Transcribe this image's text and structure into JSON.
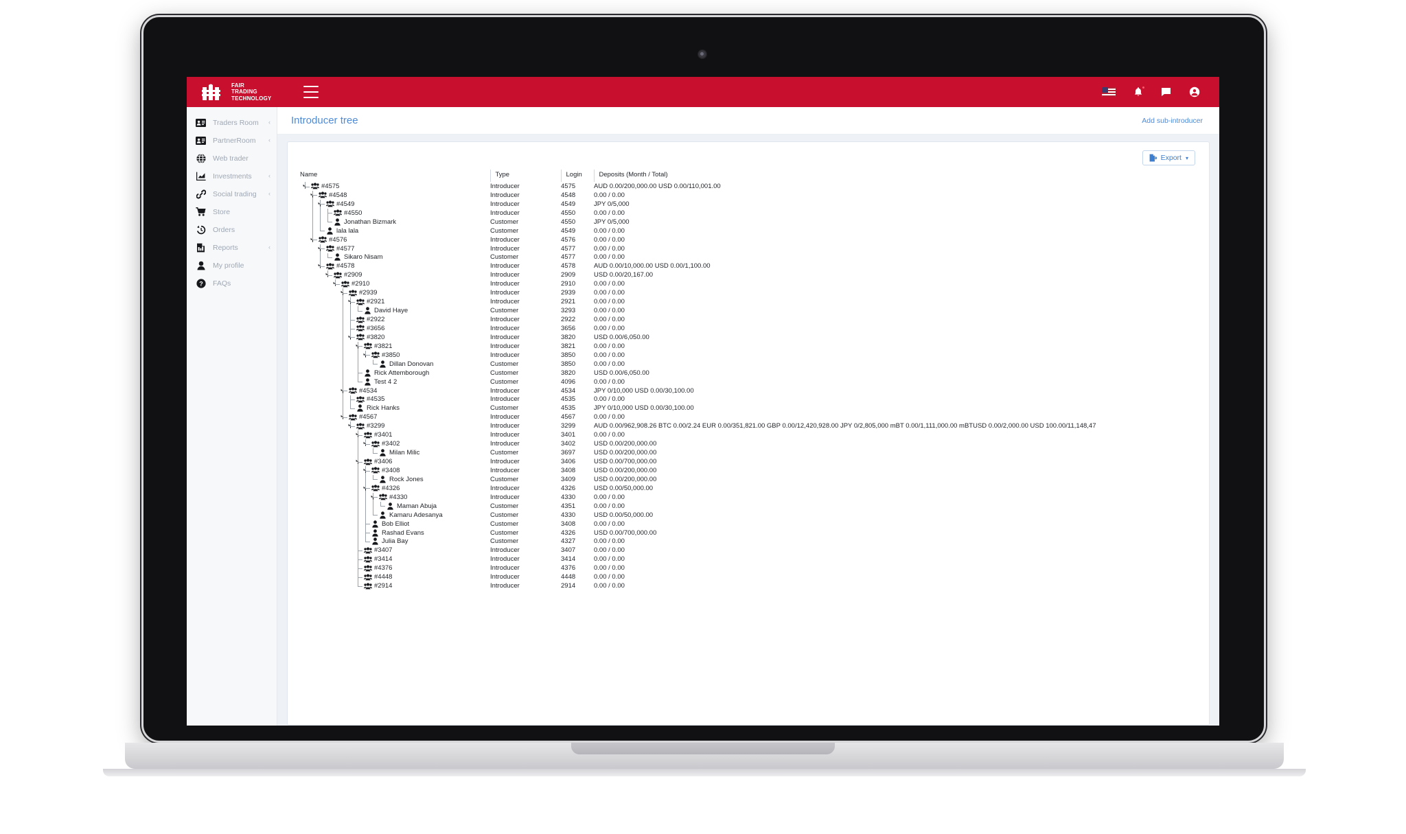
{
  "brand": {
    "line1": "FAIR",
    "line2": "TRADING",
    "line3": "TECHNOLOGY",
    "color": "#c8102e"
  },
  "topbar": {
    "menu_label": "menu",
    "icons": [
      {
        "name": "language-flag-icon",
        "label": "US"
      },
      {
        "name": "notifications-bell-icon",
        "label": "Notifications"
      },
      {
        "name": "messages-icon",
        "label": "Messages"
      },
      {
        "name": "account-icon",
        "label": "Account"
      }
    ]
  },
  "sidebar": {
    "items": [
      {
        "label": "Traders Room",
        "icon": "id-card-icon",
        "caret": "‹"
      },
      {
        "label": "PartnerRoom",
        "icon": "id-card-icon",
        "caret": "‹"
      },
      {
        "label": "Web trader",
        "icon": "globe-icon",
        "caret": ""
      },
      {
        "label": "Investments",
        "icon": "chart-icon",
        "caret": "‹"
      },
      {
        "label": "Social trading",
        "icon": "link-icon",
        "caret": "‹"
      },
      {
        "label": "Store",
        "icon": "cart-icon",
        "caret": ""
      },
      {
        "label": "Orders",
        "icon": "history-icon",
        "caret": ""
      },
      {
        "label": "Reports",
        "icon": "report-icon",
        "caret": "‹"
      },
      {
        "label": "My profile",
        "icon": "user-icon",
        "caret": ""
      },
      {
        "label": "FAQs",
        "icon": "help-icon",
        "caret": ""
      }
    ]
  },
  "page": {
    "title": "Introducer tree",
    "add_action": "Add sub-introducer",
    "export_label": "Export",
    "export_caret": "▾",
    "title_color": "#4f8bd6"
  },
  "table": {
    "columns": [
      "Name",
      "Type",
      "Login",
      "Deposits (Month / Total)"
    ],
    "rows": [
      {
        "depth": 0,
        "kind": "group",
        "name": "#4575",
        "type": "Introducer",
        "login": "4575",
        "deposits": "AUD 0.00/200,000.00 USD 0.00/110,001.00"
      },
      {
        "depth": 1,
        "kind": "group",
        "name": "#4548",
        "type": "Introducer",
        "login": "4548",
        "deposits": "0.00 / 0.00"
      },
      {
        "depth": 2,
        "kind": "group",
        "name": "#4549",
        "type": "Introducer",
        "login": "4549",
        "deposits": "JPY 0/5,000"
      },
      {
        "depth": 3,
        "kind": "group",
        "name": "#4550",
        "type": "Introducer",
        "login": "4550",
        "deposits": "0.00 / 0.00"
      },
      {
        "depth": 3,
        "kind": "customer",
        "name": "Jonathan Bizmark",
        "type": "Customer",
        "login": "4550",
        "deposits": "JPY 0/5,000"
      },
      {
        "depth": 2,
        "kind": "customer",
        "name": "lala lala",
        "type": "Customer",
        "login": "4549",
        "deposits": "0.00 / 0.00"
      },
      {
        "depth": 1,
        "kind": "group",
        "name": "#4576",
        "type": "Introducer",
        "login": "4576",
        "deposits": "0.00 / 0.00"
      },
      {
        "depth": 2,
        "kind": "group",
        "name": "#4577",
        "type": "Introducer",
        "login": "4577",
        "deposits": "0.00 / 0.00"
      },
      {
        "depth": 3,
        "kind": "customer",
        "name": "Sikaro Nisam",
        "type": "Customer",
        "login": "4577",
        "deposits": "0.00 / 0.00"
      },
      {
        "depth": 2,
        "kind": "group",
        "name": "#4578",
        "type": "Introducer",
        "login": "4578",
        "deposits": "AUD 0.00/10,000.00 USD 0.00/1,100.00"
      },
      {
        "depth": 3,
        "kind": "group",
        "name": "#2909",
        "type": "Introducer",
        "login": "2909",
        "deposits": "USD 0.00/20,167.00"
      },
      {
        "depth": 4,
        "kind": "group",
        "name": "#2910",
        "type": "Introducer",
        "login": "2910",
        "deposits": "0.00 / 0.00"
      },
      {
        "depth": 5,
        "kind": "group",
        "name": "#2939",
        "type": "Introducer",
        "login": "2939",
        "deposits": "0.00 / 0.00"
      },
      {
        "depth": 6,
        "kind": "group",
        "name": "#2921",
        "type": "Introducer",
        "login": "2921",
        "deposits": "0.00 / 0.00"
      },
      {
        "depth": 7,
        "kind": "customer",
        "name": "David Haye",
        "type": "Customer",
        "login": "3293",
        "deposits": "0.00 / 0.00"
      },
      {
        "depth": 6,
        "kind": "group",
        "name": "#2922",
        "type": "Introducer",
        "login": "2922",
        "deposits": "0.00 / 0.00"
      },
      {
        "depth": 6,
        "kind": "group",
        "name": "#3656",
        "type": "Introducer",
        "login": "3656",
        "deposits": "0.00 / 0.00"
      },
      {
        "depth": 6,
        "kind": "group",
        "name": "#3820",
        "type": "Introducer",
        "login": "3820",
        "deposits": "USD 0.00/6,050.00"
      },
      {
        "depth": 7,
        "kind": "group",
        "name": "#3821",
        "type": "Introducer",
        "login": "3821",
        "deposits": "0.00 / 0.00"
      },
      {
        "depth": 8,
        "kind": "group",
        "name": "#3850",
        "type": "Introducer",
        "login": "3850",
        "deposits": "0.00 / 0.00"
      },
      {
        "depth": 9,
        "kind": "customer",
        "name": "Dillan Donovan",
        "type": "Customer",
        "login": "3850",
        "deposits": "0.00 / 0.00"
      },
      {
        "depth": 7,
        "kind": "customer",
        "name": "Rick Attemborough",
        "type": "Customer",
        "login": "3820",
        "deposits": "USD 0.00/6,050.00"
      },
      {
        "depth": 7,
        "kind": "customer",
        "name": "Test 4 2",
        "type": "Customer",
        "login": "4096",
        "deposits": "0.00 / 0.00"
      },
      {
        "depth": 5,
        "kind": "group",
        "name": "#4534",
        "type": "Introducer",
        "login": "4534",
        "deposits": "JPY 0/10,000 USD 0.00/30,100.00"
      },
      {
        "depth": 6,
        "kind": "group",
        "name": "#4535",
        "type": "Introducer",
        "login": "4535",
        "deposits": "0.00 / 0.00"
      },
      {
        "depth": 6,
        "kind": "customer",
        "name": "Rick Hanks",
        "type": "Customer",
        "login": "4535",
        "deposits": "JPY 0/10,000 USD 0.00/30,100.00"
      },
      {
        "depth": 5,
        "kind": "group",
        "name": "#4567",
        "type": "Introducer",
        "login": "4567",
        "deposits": "0.00 / 0.00"
      },
      {
        "depth": 6,
        "kind": "group",
        "name": "#3299",
        "type": "Introducer",
        "login": "3299",
        "deposits": "AUD 0.00/962,908.26 BTC 0.00/2.24 EUR 0.00/351,821.00 GBP 0.00/12,420,928.00 JPY 0/2,805,000 mBT 0.00/1,111,000.00 mBTUSD 0.00/2,000.00 USD 100.00/11,148,47"
      },
      {
        "depth": 7,
        "kind": "group",
        "name": "#3401",
        "type": "Introducer",
        "login": "3401",
        "deposits": "0.00 / 0.00"
      },
      {
        "depth": 8,
        "kind": "group",
        "name": "#3402",
        "type": "Introducer",
        "login": "3402",
        "deposits": "USD 0.00/200,000.00"
      },
      {
        "depth": 9,
        "kind": "customer",
        "name": "Milan Milic",
        "type": "Customer",
        "login": "3697",
        "deposits": "USD 0.00/200,000.00"
      },
      {
        "depth": 7,
        "kind": "group",
        "name": "#3406",
        "type": "Introducer",
        "login": "3406",
        "deposits": "USD 0.00/700,000.00"
      },
      {
        "depth": 8,
        "kind": "group",
        "name": "#3408",
        "type": "Introducer",
        "login": "3408",
        "deposits": "USD 0.00/200,000.00"
      },
      {
        "depth": 9,
        "kind": "customer",
        "name": "Rock Jones",
        "type": "Customer",
        "login": "3409",
        "deposits": "USD 0.00/200,000.00"
      },
      {
        "depth": 8,
        "kind": "group",
        "name": "#4326",
        "type": "Introducer",
        "login": "4326",
        "deposits": "USD 0.00/50,000.00"
      },
      {
        "depth": 9,
        "kind": "group",
        "name": "#4330",
        "type": "Introducer",
        "login": "4330",
        "deposits": "0.00 / 0.00"
      },
      {
        "depth": 10,
        "kind": "customer",
        "name": "Maman Abuja",
        "type": "Customer",
        "login": "4351",
        "deposits": "0.00 / 0.00"
      },
      {
        "depth": 9,
        "kind": "customer",
        "name": "Kamaru Adesanya",
        "type": "Customer",
        "login": "4330",
        "deposits": "USD 0.00/50,000.00"
      },
      {
        "depth": 8,
        "kind": "customer",
        "name": "Bob Elliot",
        "type": "Customer",
        "login": "3408",
        "deposits": "0.00 / 0.00"
      },
      {
        "depth": 8,
        "kind": "customer",
        "name": "Rashad Evans",
        "type": "Customer",
        "login": "4326",
        "deposits": "USD 0.00/700,000.00"
      },
      {
        "depth": 8,
        "kind": "customer",
        "name": "Julia Bay",
        "type": "Customer",
        "login": "4327",
        "deposits": "0.00 / 0.00"
      },
      {
        "depth": 7,
        "kind": "group",
        "name": "#3407",
        "type": "Introducer",
        "login": "3407",
        "deposits": "0.00 / 0.00"
      },
      {
        "depth": 7,
        "kind": "group",
        "name": "#3414",
        "type": "Introducer",
        "login": "3414",
        "deposits": "0.00 / 0.00"
      },
      {
        "depth": 7,
        "kind": "group",
        "name": "#4376",
        "type": "Introducer",
        "login": "4376",
        "deposits": "0.00 / 0.00"
      },
      {
        "depth": 7,
        "kind": "group",
        "name": "#4448",
        "type": "Introducer",
        "login": "4448",
        "deposits": "0.00 / 0.00"
      },
      {
        "depth": 7,
        "kind": "group",
        "name": "#2914",
        "type": "Introducer",
        "login": "2914",
        "deposits": "0.00 / 0.00"
      }
    ]
  }
}
